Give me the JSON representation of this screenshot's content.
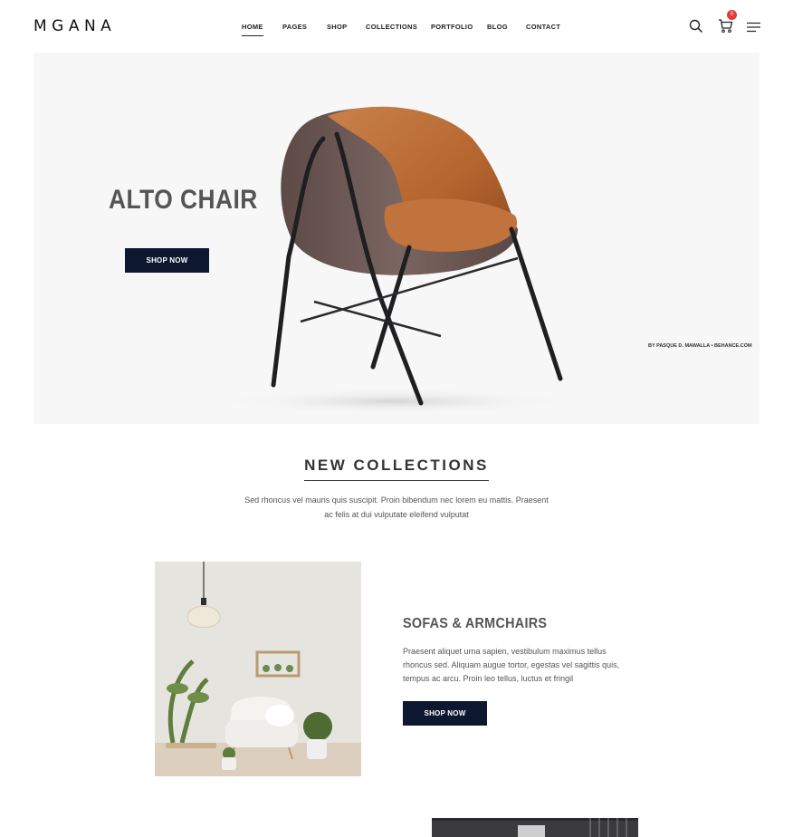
{
  "header": {
    "logo": "MGANA",
    "nav": [
      {
        "label": "HOME",
        "active": true
      },
      {
        "label": "PAGES",
        "active": false
      },
      {
        "label": "SHOP",
        "active": false
      },
      {
        "label": "COLLECTIONS",
        "active": false
      },
      {
        "label": "PORTFOLIO",
        "active": false
      },
      {
        "label": "BLOG",
        "active": false
      },
      {
        "label": "CONTACT",
        "active": false
      }
    ],
    "cart_count": "0",
    "icons": [
      "search-icon",
      "cart-icon",
      "menu-icon"
    ]
  },
  "hero": {
    "title": "ALTO CHAIR",
    "button_label": "SHOP NOW",
    "credit": "BY PASQUE D. MAWALLA • BEHANCE.COM"
  },
  "collections": {
    "title": "NEW COLLECTIONS",
    "description_lines": [
      "Sed rhoncus vel mauris quis suscipit. Proin bibendum nec lorem eu mattis. Praesent",
      "ac felis at dui vulputate eleifend vulputat"
    ],
    "items": [
      {
        "title": "SOFAS & ARMCHAIRS",
        "description_lines": [
          "Praesent aliquet urna sapien, vestibulum maximus tellus",
          "rhoncus sed. Aliquam augue tortor, egestas vel sagittis quis,",
          "tempus ac arcu. Proin leo tellus, luctus et fringil"
        ],
        "button_label": "SHOP NOW"
      }
    ]
  },
  "colors": {
    "accent_dark": "#0e1730",
    "badge": "#e53935",
    "hero_bg": "#f7f7f8",
    "chair_leather": "#b96a34",
    "chair_shell": "#6e5a55"
  }
}
